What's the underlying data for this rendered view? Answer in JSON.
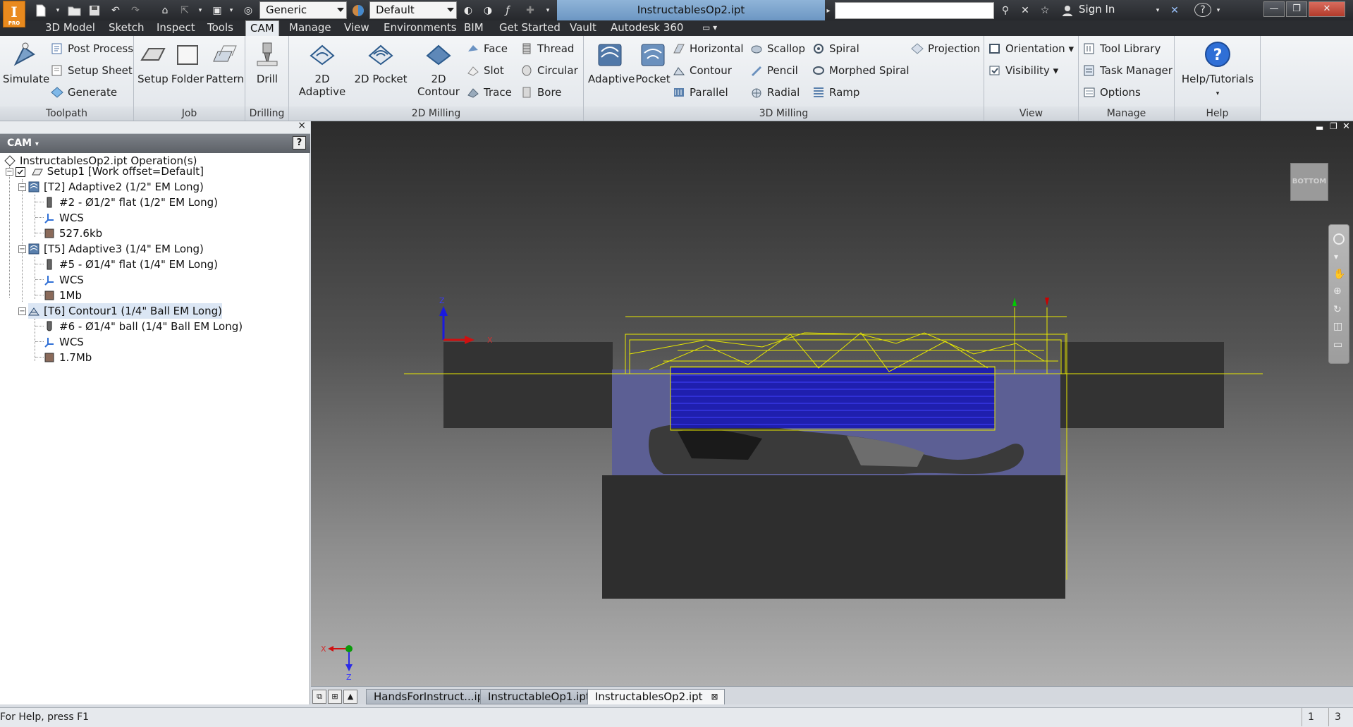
{
  "titlebar": {
    "app_logo": "I",
    "app_logo_sub": "PRO",
    "material_combo": "Generic",
    "appearance_combo": "Default",
    "document_title": "InstructablesOp2.ipt",
    "sign_in": "Sign In",
    "help": "?"
  },
  "menu_tabs": [
    "3D Model",
    "Sketch",
    "Inspect",
    "Tools",
    "CAM",
    "Manage",
    "View",
    "Environments",
    "BIM",
    "Get Started",
    "Vault",
    "Autodesk 360"
  ],
  "active_tab": "CAM",
  "ribbon": {
    "toolpath": {
      "title": "Toolpath",
      "simulate": "Simulate",
      "post_process": "Post Process",
      "setup_sheet": "Setup Sheet",
      "generate": "Generate"
    },
    "job": {
      "title": "Job",
      "setup": "Setup",
      "folder": "Folder",
      "pattern": "Pattern"
    },
    "drilling": {
      "title": "Drilling",
      "drill": "Drill"
    },
    "milling2d": {
      "title": "2D Milling",
      "adaptive": "2D Adaptive",
      "pocket": "2D Pocket",
      "contour": "2D Contour",
      "face": "Face",
      "slot": "Slot",
      "trace": "Trace",
      "thread": "Thread",
      "circular": "Circular",
      "bore": "Bore"
    },
    "milling3d": {
      "title": "3D Milling",
      "adaptive": "Adaptive",
      "pocket": "Pocket",
      "horizontal": "Horizontal",
      "contour": "Contour",
      "parallel": "Parallel",
      "scallop": "Scallop",
      "pencil": "Pencil",
      "radial": "Radial",
      "spiral": "Spiral",
      "morphed_spiral": "Morphed Spiral",
      "ramp": "Ramp",
      "projection": "Projection"
    },
    "view": {
      "title": "View",
      "orientation": "Orientation",
      "visibility": "Visibility"
    },
    "manage": {
      "title": "Manage",
      "tool_library": "Tool Library",
      "task_manager": "Task Manager",
      "options": "Options"
    },
    "help": {
      "title": "Help",
      "tutorials": "Help/Tutorials"
    }
  },
  "browser": {
    "close": "×",
    "header": "CAM",
    "help": "?",
    "tree": [
      {
        "label": "InstructablesOp2.ipt Operation(s)"
      },
      {
        "label": "Setup1 [Work offset=Default]"
      },
      {
        "label": "[T2] Adaptive2 (1/2\" EM Long)"
      },
      {
        "label": "#2 - Ø1/2\" flat (1/2\" EM Long)"
      },
      {
        "label": "WCS"
      },
      {
        "label": "527.6kb"
      },
      {
        "label": "[T5] Adaptive3 (1/4\" EM Long)"
      },
      {
        "label": "#5 - Ø1/4\" flat (1/4\" EM Long)"
      },
      {
        "label": "WCS"
      },
      {
        "label": "1Mb"
      },
      {
        "label": "[T6] Contour1 (1/4\" Ball EM Long)"
      },
      {
        "label": "#6 - Ø1/4\" ball (1/4\" Ball EM Long)"
      },
      {
        "label": "WCS"
      },
      {
        "label": "1.7Mb"
      }
    ]
  },
  "viewport": {
    "viewcube_label": "BOTTOM",
    "axis_z": "Z",
    "axis_x": "X"
  },
  "doc_tabs": [
    "HandsForInstruct...ipt",
    "InstructableOp1.ipt",
    "InstructablesOp2.ipt"
  ],
  "status": {
    "help_text": "For Help, press F1",
    "count1": "1",
    "count2": "3"
  }
}
